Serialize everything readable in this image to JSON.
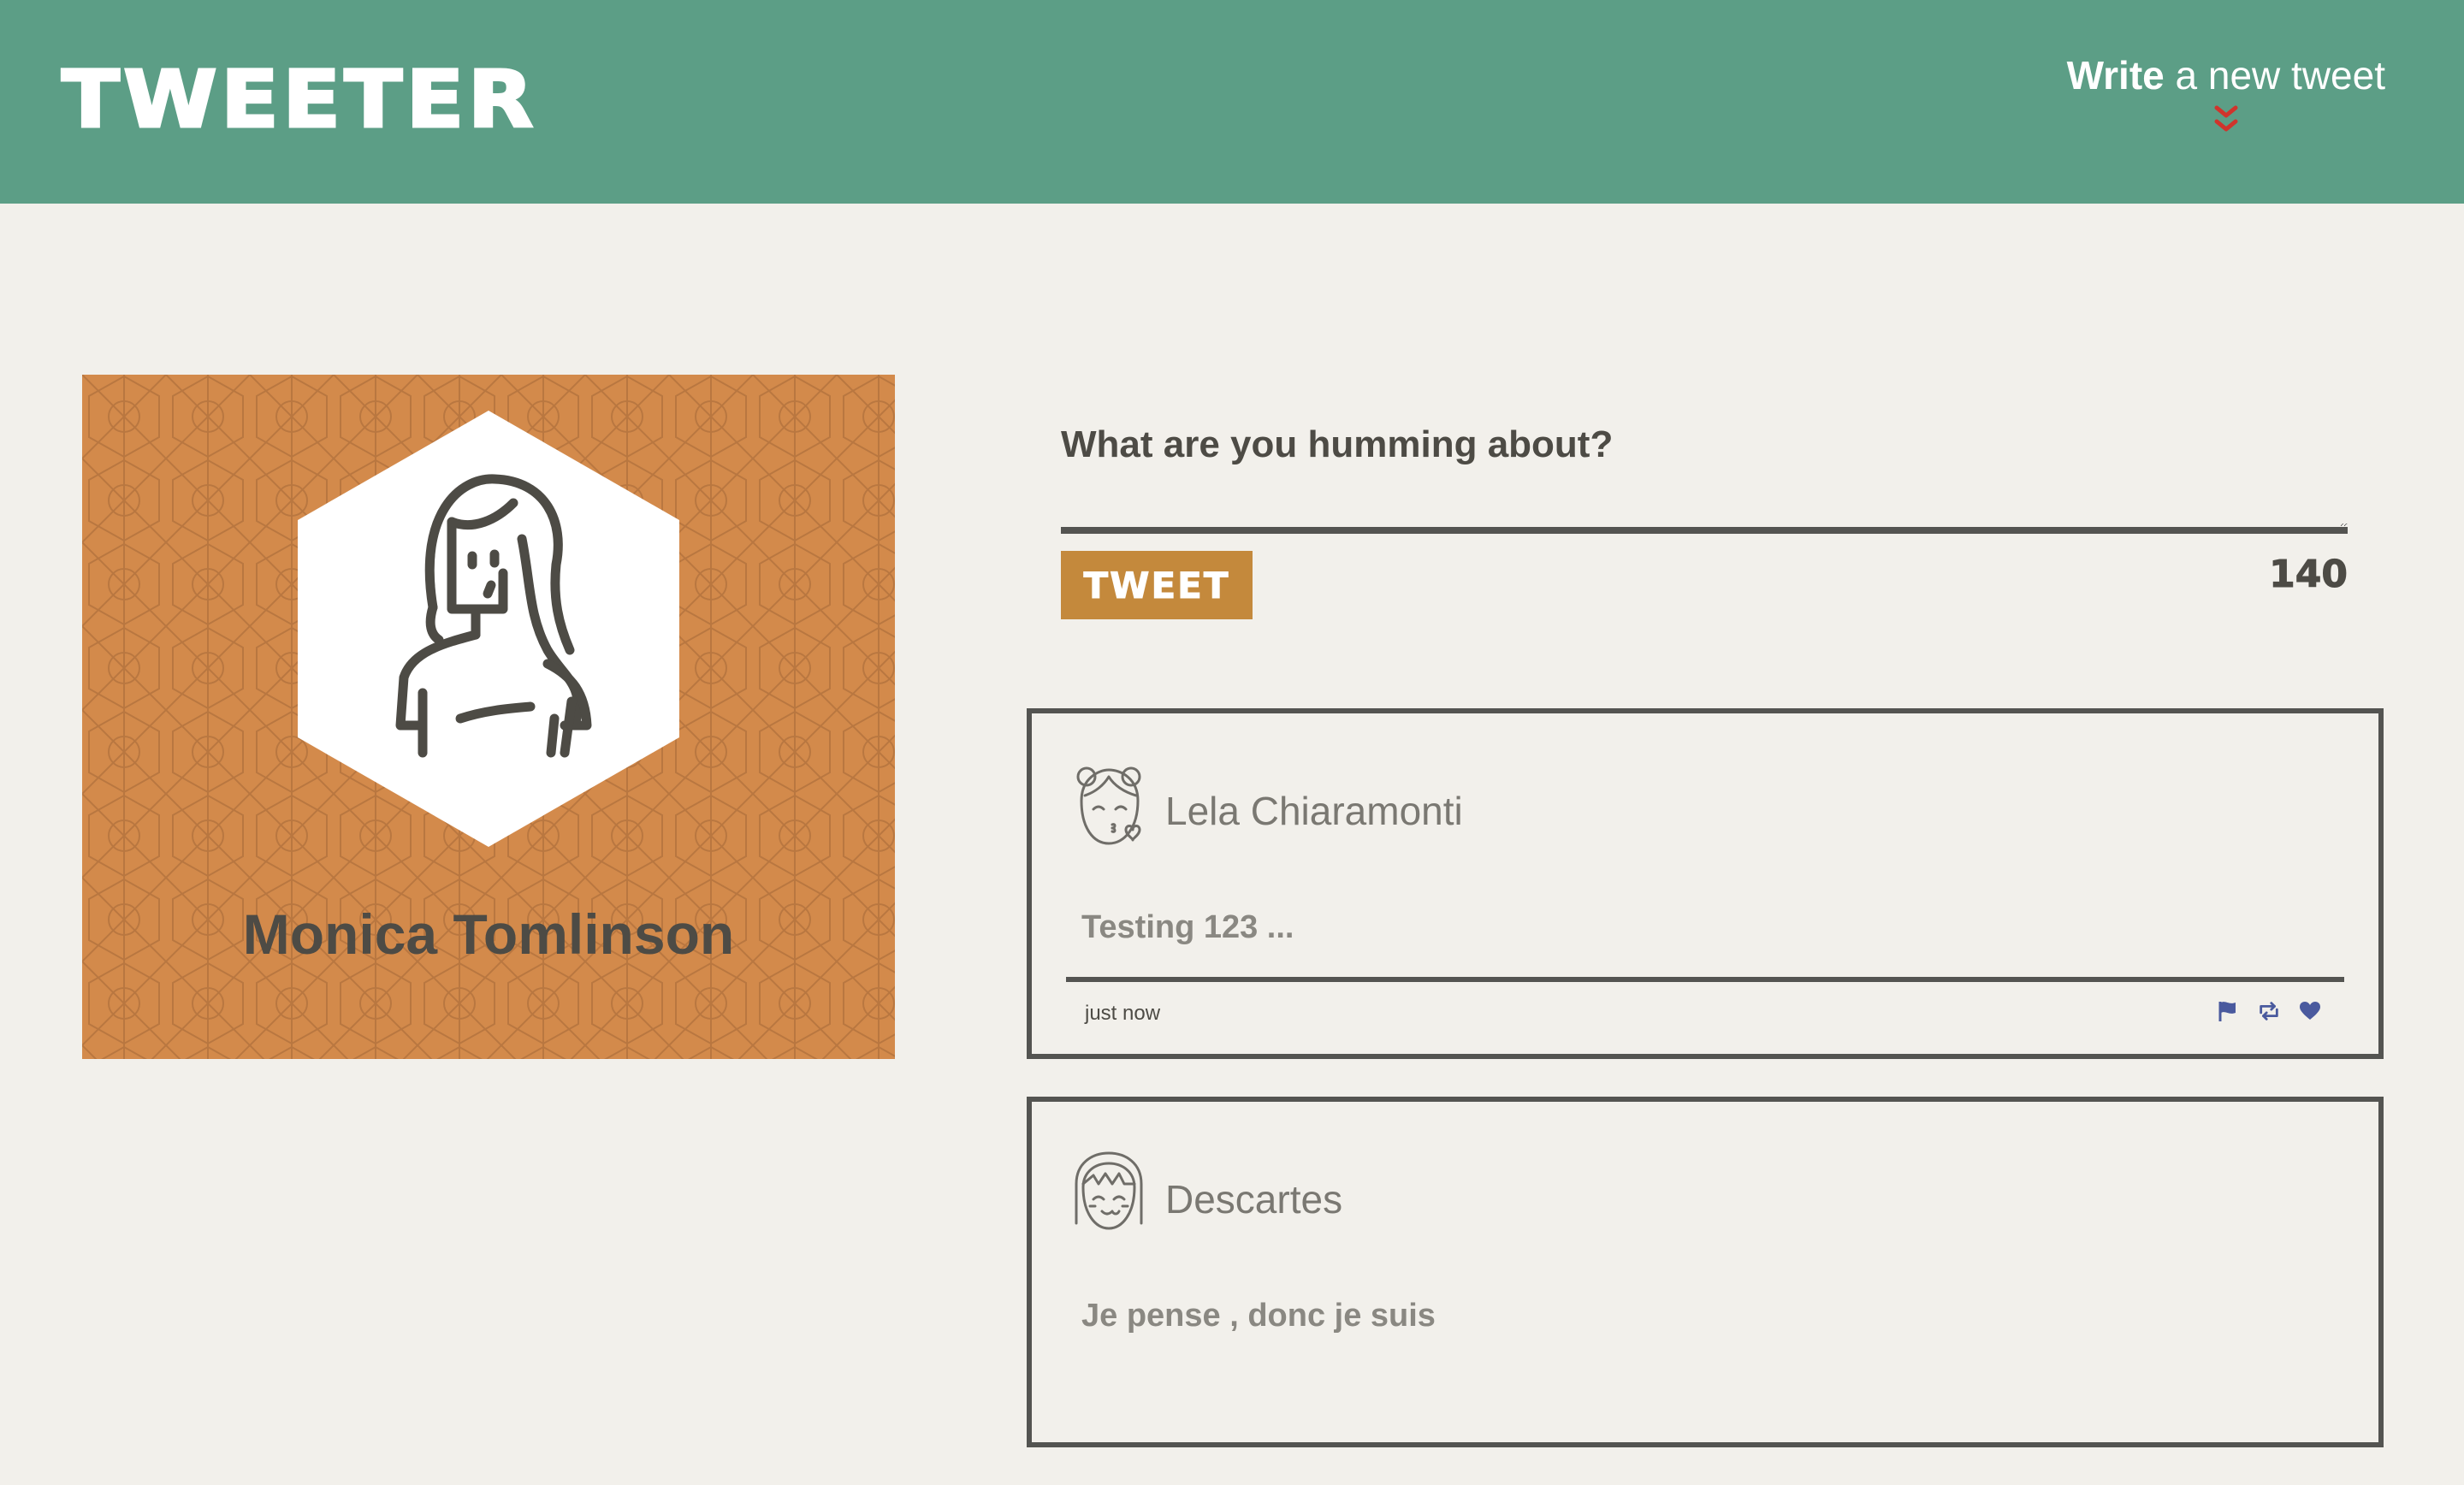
{
  "header": {
    "logo": "TWEETER",
    "compose_toggle": {
      "bold": "Write",
      "rest": " a new tweet",
      "icon": "double-chevron-down-icon"
    }
  },
  "profile": {
    "name": "Monica Tomlinson",
    "avatar_icon": "woman-avatar-icon"
  },
  "composer": {
    "prompt": "What are you humming about?",
    "button_label": "TWEET",
    "char_count": "140"
  },
  "tweets": [
    {
      "author": "Lela Chiaramonti",
      "avatar_icon": "girl-blowing-kiss-avatar-icon",
      "text": "Testing 123 ...",
      "time": "just now",
      "actions": [
        "flag-icon",
        "retweet-icon",
        "heart-icon"
      ]
    },
    {
      "author": "Descartes",
      "avatar_icon": "girl-bangs-avatar-icon",
      "text": "Je pense , donc je suis"
    }
  ],
  "colors": {
    "header_bg": "#5c9e86",
    "page_bg": "#f2f0eb",
    "profile_bg": "#d38a4b",
    "button_bg": "#c4893c",
    "chevron": "#d0342c",
    "action_icons": "#4a5a9e",
    "text_dark": "#4d4b45"
  }
}
